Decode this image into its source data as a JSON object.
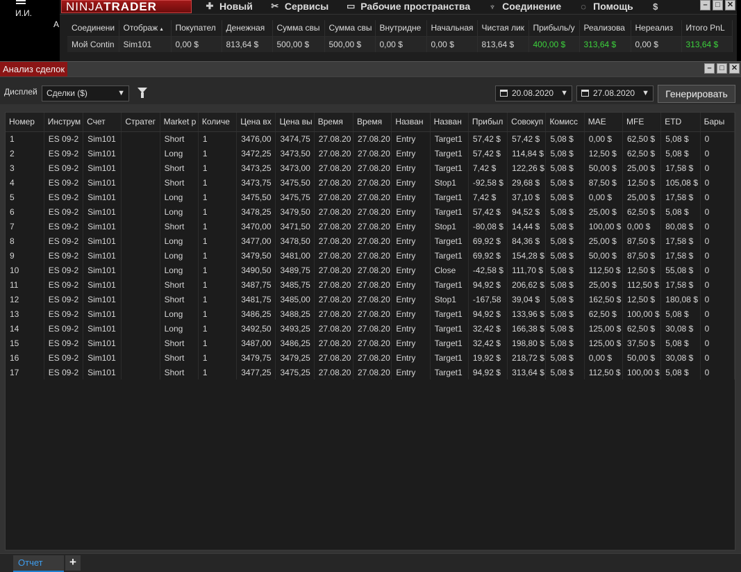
{
  "user": {
    "name": "И.И.",
    "cut_label": "А"
  },
  "app": {
    "logo_light": "NINJA",
    "logo_bold": "TRADER",
    "menu": [
      {
        "icon": "plus-icon",
        "glyph": "✚",
        "label": "Новый"
      },
      {
        "icon": "tools-icon",
        "glyph": "✂",
        "label": "Сервисы"
      },
      {
        "icon": "workspace-icon",
        "glyph": "▭",
        "label": "Рабочие пространства"
      },
      {
        "icon": "plug-icon",
        "glyph": "♆",
        "label": "Соединение"
      },
      {
        "icon": "help-icon",
        "glyph": "◌",
        "label": "Помощь"
      },
      {
        "icon": "dollar-icon",
        "glyph": "$",
        "label": ""
      }
    ]
  },
  "accounts": {
    "headers": [
      "Соединени",
      "Отображ",
      "Покупател",
      "Денежная",
      "Сумма свы",
      "Сумма свы",
      "Внутридне",
      "Начальная",
      "Чистая лик",
      "Прибыль/у",
      "Реализова",
      "Нереализ",
      "Итого PnL"
    ],
    "row": [
      "Мой Contin",
      "Sim101",
      "0,00 $",
      "813,64 $",
      "500,00 $",
      "500,00 $",
      "0,00 $",
      "0,00 $",
      "813,64 $",
      "400,00 $",
      "313,64 $",
      "0,00 $",
      "313,64 $"
    ],
    "sorted_column_marker": "▲"
  },
  "analysis": {
    "title": "Анализ сделок",
    "display_label": "Дисплей",
    "display_value": "Сделки ($)",
    "date_from": "20.08.2020",
    "date_to": "27.08.2020",
    "generate_label": "Генерировать",
    "columns": [
      "Номер",
      "Инструм",
      "Счет",
      "Стратег",
      "Market p",
      "Количе",
      "Цена вх",
      "Цена вы",
      "Время",
      "Время",
      "Назван",
      "Назван",
      "Прибыл",
      "Совокуп",
      "Комисс",
      "MAE",
      "MFE",
      "ETD",
      "Бары"
    ],
    "rows": [
      [
        "1",
        "ES 09-2",
        "Sim101",
        "",
        "Short",
        "1",
        "3476,00",
        "3474,75",
        "27.08.20",
        "27.08.20",
        "Entry",
        "Target1",
        "57,42 $",
        "57,42 $",
        "5,08 $",
        "0,00 $",
        "62,50 $",
        "5,08 $",
        "0"
      ],
      [
        "2",
        "ES 09-2",
        "Sim101",
        "",
        "Long",
        "1",
        "3472,25",
        "3473,50",
        "27.08.20",
        "27.08.20",
        "Entry",
        "Target1",
        "57,42 $",
        "114,84 $",
        "5,08 $",
        "12,50 $",
        "62,50 $",
        "5,08 $",
        "0"
      ],
      [
        "3",
        "ES 09-2",
        "Sim101",
        "",
        "Short",
        "1",
        "3473,25",
        "3473,00",
        "27.08.20",
        "27.08.20",
        "Entry",
        "Target1",
        "7,42 $",
        "122,26 $",
        "5,08 $",
        "50,00 $",
        "25,00 $",
        "17,58 $",
        "0"
      ],
      [
        "4",
        "ES 09-2",
        "Sim101",
        "",
        "Short",
        "1",
        "3473,75",
        "3475,50",
        "27.08.20",
        "27.08.20",
        "Entry",
        "Stop1",
        "-92,58 $",
        "29,68 $",
        "5,08 $",
        "87,50 $",
        "12,50 $",
        "105,08 $",
        "0"
      ],
      [
        "5",
        "ES 09-2",
        "Sim101",
        "",
        "Long",
        "1",
        "3475,50",
        "3475,75",
        "27.08.20",
        "27.08.20",
        "Entry",
        "Target1",
        "7,42 $",
        "37,10 $",
        "5,08 $",
        "0,00 $",
        "25,00 $",
        "17,58 $",
        "0"
      ],
      [
        "6",
        "ES 09-2",
        "Sim101",
        "",
        "Long",
        "1",
        "3478,25",
        "3479,50",
        "27.08.20",
        "27.08.20",
        "Entry",
        "Target1",
        "57,42 $",
        "94,52 $",
        "5,08 $",
        "25,00 $",
        "62,50 $",
        "5,08 $",
        "0"
      ],
      [
        "7",
        "ES 09-2",
        "Sim101",
        "",
        "Short",
        "1",
        "3470,00",
        "3471,50",
        "27.08.20",
        "27.08.20",
        "Entry",
        "Stop1",
        "-80,08 $",
        "14,44 $",
        "5,08 $",
        "100,00 $",
        "0,00 $",
        "80,08 $",
        "0"
      ],
      [
        "8",
        "ES 09-2",
        "Sim101",
        "",
        "Long",
        "1",
        "3477,00",
        "3478,50",
        "27.08.20",
        "27.08.20",
        "Entry",
        "Target1",
        "69,92 $",
        "84,36 $",
        "5,08 $",
        "25,00 $",
        "87,50 $",
        "17,58 $",
        "0"
      ],
      [
        "9",
        "ES 09-2",
        "Sim101",
        "",
        "Long",
        "1",
        "3479,50",
        "3481,00",
        "27.08.20",
        "27.08.20",
        "Entry",
        "Target1",
        "69,92 $",
        "154,28 $",
        "5,08 $",
        "50,00 $",
        "87,50 $",
        "17,58 $",
        "0"
      ],
      [
        "10",
        "ES 09-2",
        "Sim101",
        "",
        "Long",
        "1",
        "3490,50",
        "3489,75",
        "27.08.20",
        "27.08.20",
        "Entry",
        "Close",
        "-42,58 $",
        "111,70 $",
        "5,08 $",
        "112,50 $",
        "12,50 $",
        "55,08 $",
        "0"
      ],
      [
        "11",
        "ES 09-2",
        "Sim101",
        "",
        "Short",
        "1",
        "3487,75",
        "3485,75",
        "27.08.20",
        "27.08.20",
        "Entry",
        "Target1",
        "94,92 $",
        "206,62 $",
        "5,08 $",
        "25,00 $",
        "112,50 $",
        "17,58 $",
        "0"
      ],
      [
        "12",
        "ES 09-2",
        "Sim101",
        "",
        "Short",
        "1",
        "3481,75",
        "3485,00",
        "27.08.20",
        "27.08.20",
        "Entry",
        "Stop1",
        "-167,58",
        "39,04 $",
        "5,08 $",
        "162,50 $",
        "12,50 $",
        "180,08 $",
        "0"
      ],
      [
        "13",
        "ES 09-2",
        "Sim101",
        "",
        "Long",
        "1",
        "3486,25",
        "3488,25",
        "27.08.20",
        "27.08.20",
        "Entry",
        "Target1",
        "94,92 $",
        "133,96 $",
        "5,08 $",
        "62,50 $",
        "100,00 $",
        "5,08 $",
        "0"
      ],
      [
        "14",
        "ES 09-2",
        "Sim101",
        "",
        "Long",
        "1",
        "3492,50",
        "3493,25",
        "27.08.20",
        "27.08.20",
        "Entry",
        "Target1",
        "32,42 $",
        "166,38 $",
        "5,08 $",
        "125,00 $",
        "62,50 $",
        "30,08 $",
        "0"
      ],
      [
        "15",
        "ES 09-2",
        "Sim101",
        "",
        "Short",
        "1",
        "3487,00",
        "3486,25",
        "27.08.20",
        "27.08.20",
        "Entry",
        "Target1",
        "32,42 $",
        "198,80 $",
        "5,08 $",
        "125,00 $",
        "37,50 $",
        "5,08 $",
        "0"
      ],
      [
        "16",
        "ES 09-2",
        "Sim101",
        "",
        "Short",
        "1",
        "3479,75",
        "3479,25",
        "27.08.20",
        "27.08.20",
        "Entry",
        "Target1",
        "19,92 $",
        "218,72 $",
        "5,08 $",
        "0,00 $",
        "50,00 $",
        "30,08 $",
        "0"
      ],
      [
        "17",
        "ES 09-2",
        "Sim101",
        "",
        "Short",
        "1",
        "3477,25",
        "3475,25",
        "27.08.20",
        "27.08.20",
        "Entry",
        "Target1",
        "94,92 $",
        "313,64 $",
        "5,08 $",
        "112,50 $",
        "100,00 $",
        "5,08 $",
        "0"
      ]
    ]
  },
  "bottom": {
    "report_tab": "Отчет",
    "add_tab_glyph": "+"
  },
  "colors": {
    "brand_red": "#8b1515",
    "profit_green": "#3cd23c",
    "loss_red": "#e02020",
    "tab_blue": "#3f9eef"
  }
}
